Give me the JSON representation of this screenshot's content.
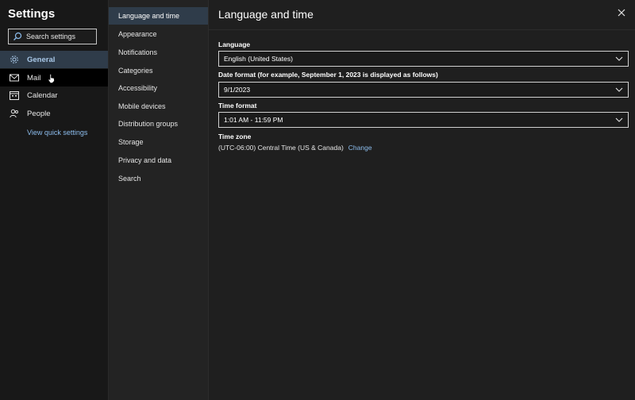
{
  "sidebar": {
    "title": "Settings",
    "search_placeholder": "Search settings",
    "items": [
      {
        "label": "General",
        "icon": "gear-icon"
      },
      {
        "label": "Mail",
        "icon": "mail-icon"
      },
      {
        "label": "Calendar",
        "icon": "calendar-icon"
      },
      {
        "label": "People",
        "icon": "people-icon"
      }
    ],
    "quick_settings_link": "View quick settings"
  },
  "subnav": {
    "items": [
      "Language and time",
      "Appearance",
      "Notifications",
      "Categories",
      "Accessibility",
      "Mobile devices",
      "Distribution groups",
      "Storage",
      "Privacy and data",
      "Search"
    ]
  },
  "main": {
    "title": "Language and time",
    "language_label": "Language",
    "language_value": "English (United States)",
    "date_format_label": "Date format (for example, September 1, 2023 is displayed as follows)",
    "date_format_value": "9/1/2023",
    "time_format_label": "Time format",
    "time_format_value": "1:01 AM - 11:59 PM",
    "time_zone_label": "Time zone",
    "time_zone_value": "(UTC-06:00) Central Time (US & Canada)",
    "time_zone_change": "Change"
  },
  "colors": {
    "accent": "#8cbcec",
    "selected_bg": "#2f3c4a",
    "background": "#1f1f1f"
  }
}
